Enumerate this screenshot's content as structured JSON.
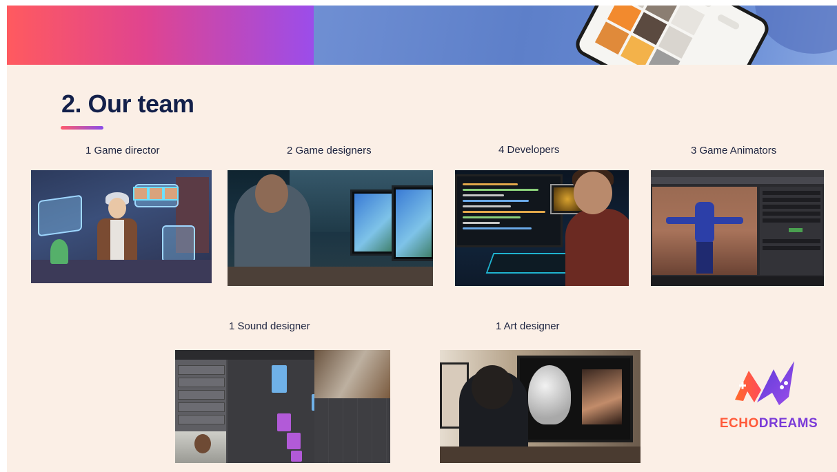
{
  "slide": {
    "title": "2. Our team"
  },
  "team": [
    {
      "caption": "1 Game director"
    },
    {
      "caption": "2 Game designers"
    },
    {
      "caption": "4 Developers"
    },
    {
      "caption": "3 Game Animators"
    },
    {
      "caption": "1 Sound designer"
    },
    {
      "caption": "1 Art designer"
    }
  ],
  "logo": {
    "text_part1": "ECHO",
    "text_part2": "DREAMS",
    "colors": {
      "orange": "#ff5a3a",
      "purple": "#7a3bd8"
    }
  },
  "colors": {
    "background": "#fbefe6",
    "title": "#13204a",
    "accent_gradient_start": "#ff5a5f",
    "accent_gradient_end": "#9b4dea"
  }
}
